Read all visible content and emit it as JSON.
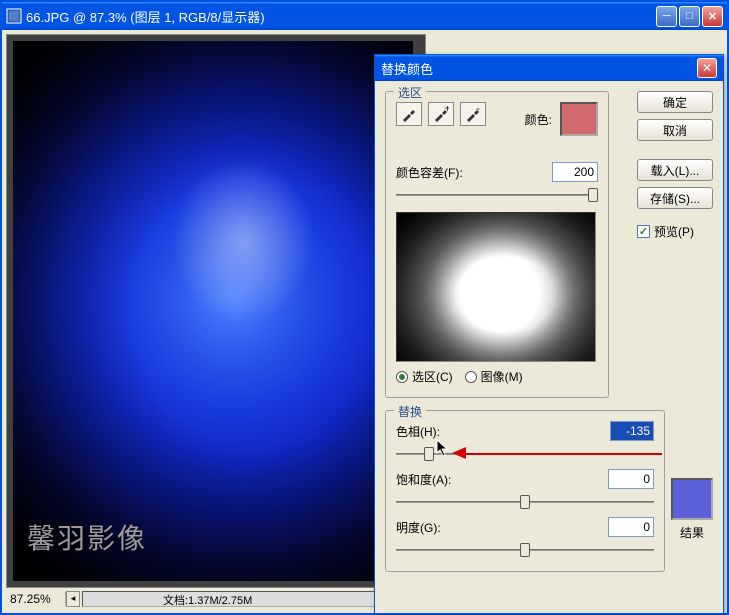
{
  "main_window": {
    "title": "66.JPG @ 87.3% (图层 1, RGB/8/显示器)",
    "zoom": "87.25%",
    "doc_info": "文档:1.37M/2.75M",
    "watermark": "馨羽影像"
  },
  "dialog": {
    "title": "替换颜色",
    "selection_legend": "选区",
    "color_label": "颜色:",
    "selection_color": "#d16a6e",
    "fuzziness_label": "颜色容差(F):",
    "fuzziness_value": "200",
    "radio_selection": "选区(C)",
    "radio_image": "图像(M)",
    "replace_legend": "替换",
    "hue_label": "色相(H):",
    "hue_value": "-135",
    "saturation_label": "饱和度(A):",
    "saturation_value": "0",
    "lightness_label": "明度(G):",
    "lightness_value": "0",
    "result_label": "结果",
    "result_color": "#5b60d8",
    "buttons": {
      "ok": "确定",
      "cancel": "取消",
      "load": "载入(L)...",
      "save": "存储(S)..."
    },
    "preview_label": "预览(P)"
  }
}
